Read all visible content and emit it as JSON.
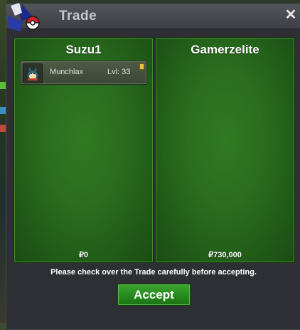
{
  "window": {
    "title": "Trade",
    "close_glyph": "✕"
  },
  "trade": {
    "left": {
      "username": "Suzu1",
      "items": [
        {
          "name": "Munchlax",
          "level": "Lvl: 33"
        }
      ],
      "money": "₽0"
    },
    "right": {
      "username": "Gamerzelite",
      "items": [],
      "money": "₽730,000"
    }
  },
  "notice": "Please check over the Trade carefully before accepting.",
  "accept_label": "Accept",
  "colors": {
    "panel_green": "#2a6d1e",
    "accept_green": "#258a1c",
    "title_bar": "#4a4c53"
  },
  "icons": [
    "pokeball-logo-icon",
    "close-icon",
    "munchlax-sprite-icon",
    "item-flag-icon"
  ]
}
